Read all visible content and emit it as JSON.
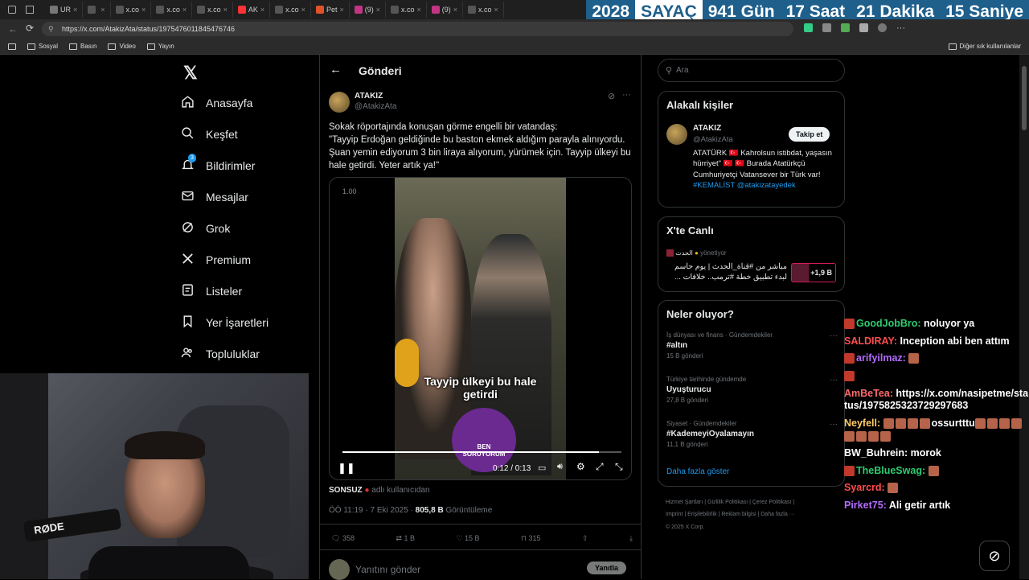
{
  "browser": {
    "tabs": [
      "UR",
      "",
      "x.co",
      "x.co",
      "x.co",
      "AK",
      "x.co",
      "Pet",
      "(9)",
      "x.co",
      "(9)",
      "x.co"
    ],
    "url": "https://x.com/AtakizAta/status/1975476011845476746",
    "bookmarks": [
      "Sosyal",
      "Basın",
      "Video",
      "Yayın"
    ],
    "other_bookmarks": "Diğer sık kullanılanlar"
  },
  "counter": {
    "year": "2028",
    "label": "SAYAÇ",
    "days": "941 Gün",
    "hours": "17 Saat",
    "minutes": "21 Dakika",
    "seconds": "15 Saniye"
  },
  "nav": {
    "items": [
      {
        "label": "Anasayfa",
        "icon": "home-icon"
      },
      {
        "label": "Keşfet",
        "icon": "search-icon"
      },
      {
        "label": "Bildirimler",
        "icon": "bell-icon",
        "badge": "3"
      },
      {
        "label": "Mesajlar",
        "icon": "mail-icon"
      },
      {
        "label": "Grok",
        "icon": "grok-icon"
      },
      {
        "label": "Premium",
        "icon": "x-logo-icon"
      },
      {
        "label": "Listeler",
        "icon": "list-icon"
      },
      {
        "label": "Yer İşaretleri",
        "icon": "bookmark-icon"
      },
      {
        "label": "Topluluklar",
        "icon": "people-icon"
      }
    ]
  },
  "post": {
    "header": "Gönderi",
    "author_name": "ATAKIZ",
    "author_handle": "@AtakizAta",
    "text_line1": "Sokak röportajında konuşan görme engelli bir vatandaş:",
    "text_line2": "\"Tayyip Erdoğan geldiğinde bu baston ekmek aldığım parayla alınıyordu. Şuan yemin ediyorum 3 bin liraya alıyorum, yürümek için. Tayyip ülkeyi bu hale getirdi. Yeter artık ya!\"",
    "video": {
      "speed": "1.00",
      "caption": "Tayyip ülkeyi bu hale getirdi",
      "logo_line1": "BEN",
      "logo_line2": "SORUYORUM",
      "time": "0:12 / 0:13",
      "progress": 0.92
    },
    "quote_user": "SONSUZ",
    "quote_suffix": "adlı kullanıcıdan",
    "timestamp": "ÖÖ 11:19 · 7 Eki 2025 · ",
    "views": "805,8 B",
    "views_label": "Görüntüleme",
    "replies": "358",
    "reposts": "1 B",
    "likes": "15 B",
    "bookmarks": "315",
    "reply_placeholder": "Yanıtını gönder",
    "reply_button": "Yanıtla"
  },
  "sidebar": {
    "search_placeholder": "Ara",
    "related_title": "Alakalı kişiler",
    "related": {
      "name": "ATAKIZ",
      "handle": "@AtakizAta",
      "follow": "Takip et",
      "bio": "ATATÜRK 🇹🇷 Kahrolsun istibdat, yaşasın hürriyet\" 🇹🇷 🇹🇷 Burada Atatürkçü Cumhuriyetçi Vatansever bir Türk var!",
      "bio_links": "#KEMALİST @atakizatayedek"
    },
    "live_title": "X'te Canlı",
    "live": {
      "host": "الحدث",
      "host_suffix": "yönetiyor",
      "text": "مباشر من #قناة_الحدث | يوم حاسم لبدء تطبيق خطة #ترمب.. خلافات ...",
      "listeners": "+1,9 B"
    },
    "trends_title": "Neler oluyor?",
    "trends": [
      {
        "meta": "İş dünyası ve finans · Gündemdekiler",
        "name": "#altın",
        "count": "15 B gönderi"
      },
      {
        "meta": "Türkiye tarihinde gündemde",
        "name": "Uyuşturucu",
        "count": "27,8 B gönderi"
      },
      {
        "meta": "Siyaset · Gündemdekiler",
        "name": "#KademeyiOyalamayın",
        "count": "11,1 B gönderi"
      }
    ],
    "show_more": "Daha fazla göster",
    "footer_line1": "Hizmet Şartları  |  Gizlilik Politikası  |  Çerez Politikası  |",
    "footer_line2": "Imprint  |  Erişilebilirlik  |  Reklam bilgisi  |  Daha fazla ···",
    "footer_line3": "© 2025 X Corp."
  },
  "chat": [
    {
      "user": "GoodJobBro:",
      "color": "#2ecc71",
      "msg": "noluyor ya",
      "badge": true
    },
    {
      "user": "SALDIRAY:",
      "color": "#ff4d4d",
      "msg": "Inception abi ben attım",
      "badge": false
    },
    {
      "user": "arifyilmaz:",
      "color": "#b36bff",
      "msg": "",
      "badge": true,
      "emotes": 1
    },
    {
      "user": "",
      "color": "#fff",
      "msg": "",
      "badge": true
    },
    {
      "user": "AmBeTea:",
      "color": "#ff6b6b",
      "msg": "https://x.com/nasipetme/status/1975825323729297683",
      "badge": false
    },
    {
      "user": "Neyfell:",
      "color": "#ffcc66",
      "msg": "ossurtttu",
      "badge": false,
      "emotes": 12
    },
    {
      "user": "BW_Buhrein:",
      "color": "#ffffff",
      "msg": "morok",
      "badge": false
    },
    {
      "user": "TheBlueSwag:",
      "color": "#2ecc71",
      "msg": "",
      "badge": true,
      "emotes": 1
    },
    {
      "user": "Syarcrd:",
      "color": "#ff4d4d",
      "msg": "",
      "badge": false,
      "emotes": 1
    },
    {
      "user": "Pirket75:",
      "color": "#b36bff",
      "msg": "Ali getir artık",
      "badge": false
    }
  ],
  "webcam": {
    "mic_brand": "RØDE"
  }
}
